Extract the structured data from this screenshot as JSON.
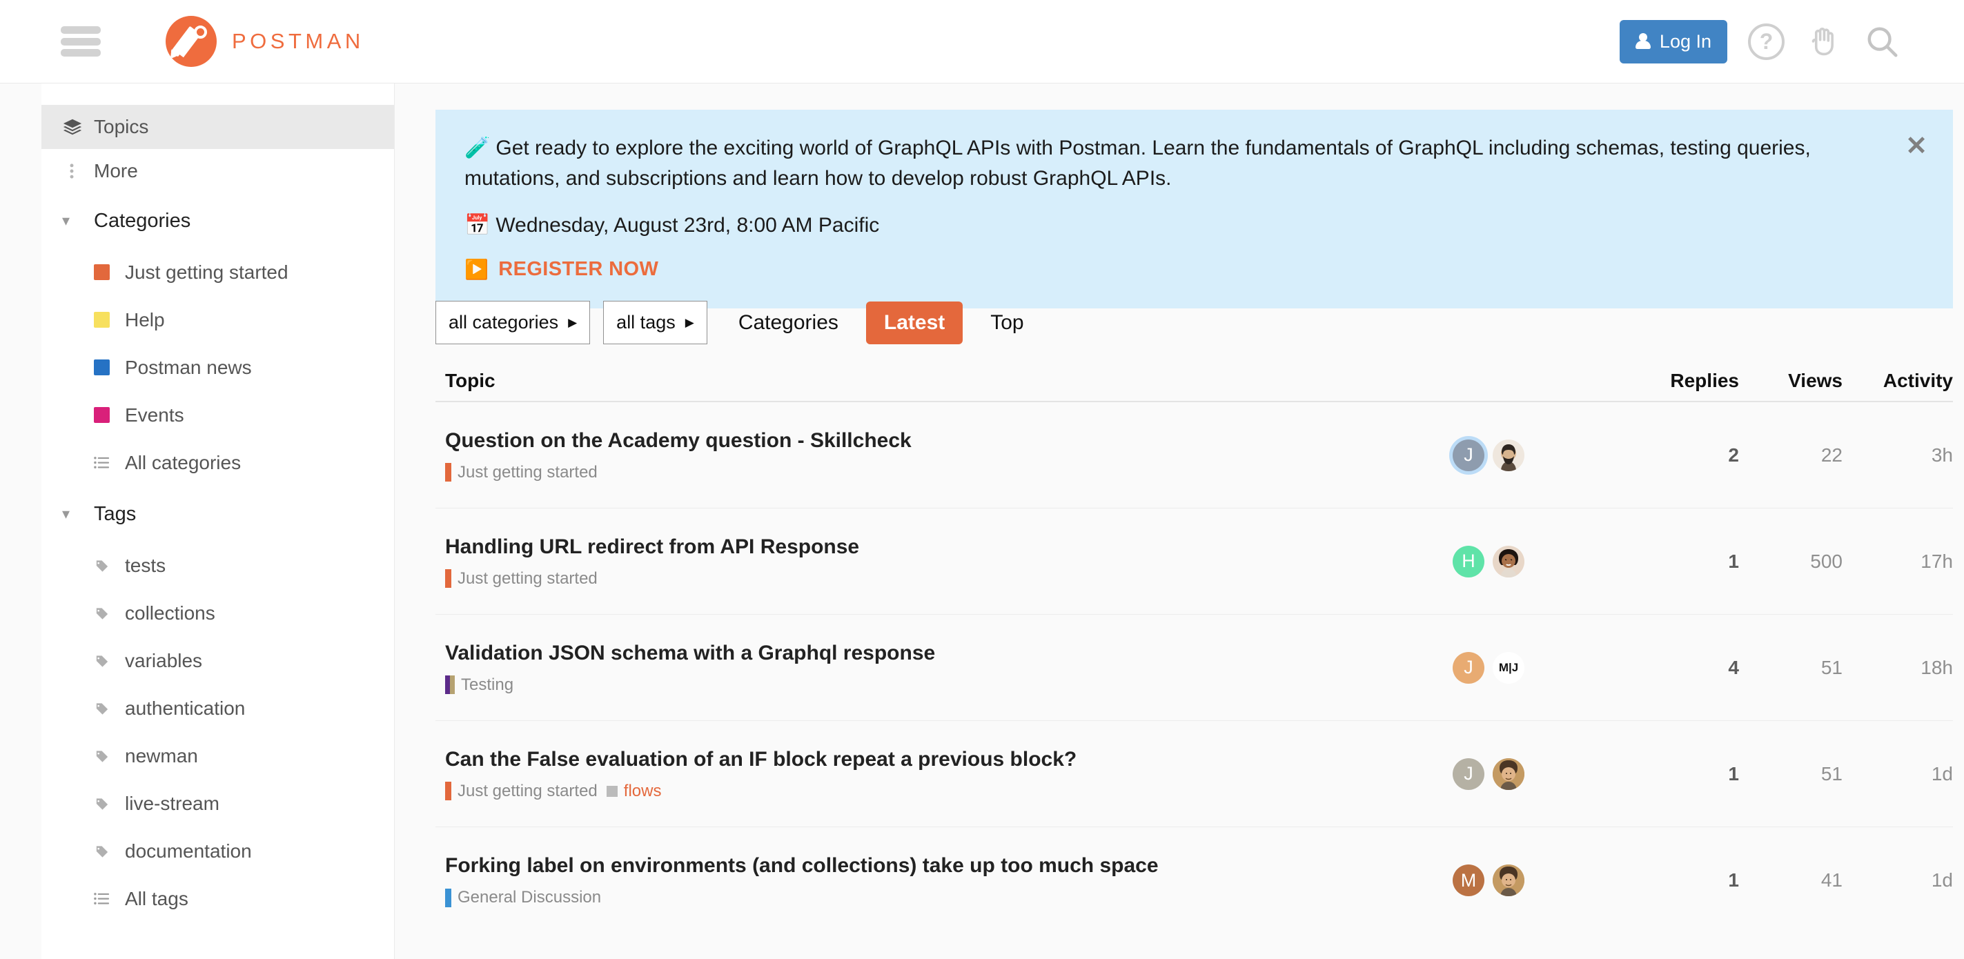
{
  "header": {
    "brand_name": "POSTMAN",
    "login_label": "Log In",
    "icons": {
      "menu": "hamburger-menu-icon",
      "logo": "postman-logo-icon",
      "user": "user-icon",
      "help": "question-circle-icon",
      "hand": "hand-icon",
      "search": "search-icon"
    },
    "accent_color": "#ef6c3e",
    "login_color": "#4184c4"
  },
  "sidebar": {
    "nav": [
      {
        "label": "Topics",
        "icon": "layers-icon",
        "active": true
      },
      {
        "label": "More",
        "icon": "dots-vertical-icon",
        "active": false
      }
    ],
    "categories_heading": "Categories",
    "categories": [
      {
        "label": "Just getting started",
        "color": "#e2683c"
      },
      {
        "label": "Help",
        "color": "#f7e05e"
      },
      {
        "label": "Postman news",
        "color": "#2672c4"
      },
      {
        "label": "Events",
        "color": "#d9207a"
      }
    ],
    "all_categories_label": "All categories",
    "tags_heading": "Tags",
    "tags": [
      "tests",
      "collections",
      "variables",
      "authentication",
      "newman",
      "live-stream",
      "documentation"
    ],
    "all_tags_label": "All tags"
  },
  "banner": {
    "emoji_test_tube": "🧪",
    "emoji_calendar": "📅",
    "emoji_play": "▶️",
    "body": "Get ready to explore the exciting world of GraphQL APIs with Postman. Learn the fundamentals of GraphQL including schemas, testing queries, mutations, and subscriptions and learn how to develop robust GraphQL APIs.",
    "date": "Wednesday, August 23rd, 8:00 AM Pacific",
    "cta": "REGISTER NOW",
    "close_icon": "close-icon",
    "bg_color": "#d7eefb",
    "cta_color": "#ec6c3d"
  },
  "filters": {
    "category_select": "all categories",
    "tag_select": "all tags",
    "tabs": [
      {
        "label": "Categories",
        "selected": false
      },
      {
        "label": "Latest",
        "selected": true
      },
      {
        "label": "Top",
        "selected": false
      }
    ],
    "selected_color": "#e4683c"
  },
  "table": {
    "headers": {
      "topic": "Topic",
      "replies": "Replies",
      "views": "Views",
      "activity": "Activity"
    },
    "rows": [
      {
        "title": "Question on the Academy question - Skillcheck",
        "category": "Just getting started",
        "category_color": "#e2683c",
        "category_dual": false,
        "tag": "",
        "avatars": [
          {
            "letter": "J",
            "color": "#8e9cae",
            "ring": true,
            "photo": false
          },
          {
            "letter": "",
            "color": "#efe7de",
            "ring": false,
            "photo": true,
            "face": "beard"
          }
        ],
        "replies": "2",
        "views": "22",
        "activity": "3h"
      },
      {
        "title": "Handling URL redirect from API Response",
        "category": "Just getting started",
        "category_color": "#e2683c",
        "category_dual": false,
        "tag": "",
        "avatars": [
          {
            "letter": "H",
            "color": "#5fe3a8",
            "ring": false,
            "photo": false
          },
          {
            "letter": "",
            "color": "#e8d7c8",
            "ring": false,
            "photo": true,
            "face": "woman"
          }
        ],
        "replies": "1",
        "views": "500",
        "activity": "17h"
      },
      {
        "title": "Validation JSON schema with a Graphql response",
        "category": "Testing",
        "category_color": "#5c2b8a",
        "category_dual": true,
        "tag": "",
        "avatars": [
          {
            "letter": "J",
            "color": "#e8ab72",
            "ring": false,
            "photo": false
          },
          {
            "letter": "",
            "color": "#ffffff",
            "ring": false,
            "photo": true,
            "face": "monogram",
            "monogram": "M|J"
          }
        ],
        "replies": "4",
        "views": "51",
        "activity": "18h"
      },
      {
        "title": "Can the False evaluation of an IF block repeat a previous block?",
        "category": "Just getting started",
        "category_color": "#e2683c",
        "category_dual": false,
        "tag": "flows",
        "avatars": [
          {
            "letter": "J",
            "color": "#b5b1a4",
            "ring": false,
            "photo": false
          },
          {
            "letter": "",
            "color": "#c8a070",
            "ring": false,
            "photo": true,
            "face": "man"
          }
        ],
        "replies": "1",
        "views": "51",
        "activity": "1d"
      },
      {
        "title": "Forking label on environments (and collections) take up too much space",
        "category": "General Discussion",
        "category_color": "#3a92d4",
        "category_dual": false,
        "tag": "",
        "avatars": [
          {
            "letter": "M",
            "color": "#bb7243",
            "ring": false,
            "photo": false
          },
          {
            "letter": "",
            "color": "#c8a070",
            "ring": false,
            "photo": true,
            "face": "man"
          }
        ],
        "replies": "1",
        "views": "41",
        "activity": "1d"
      }
    ]
  }
}
